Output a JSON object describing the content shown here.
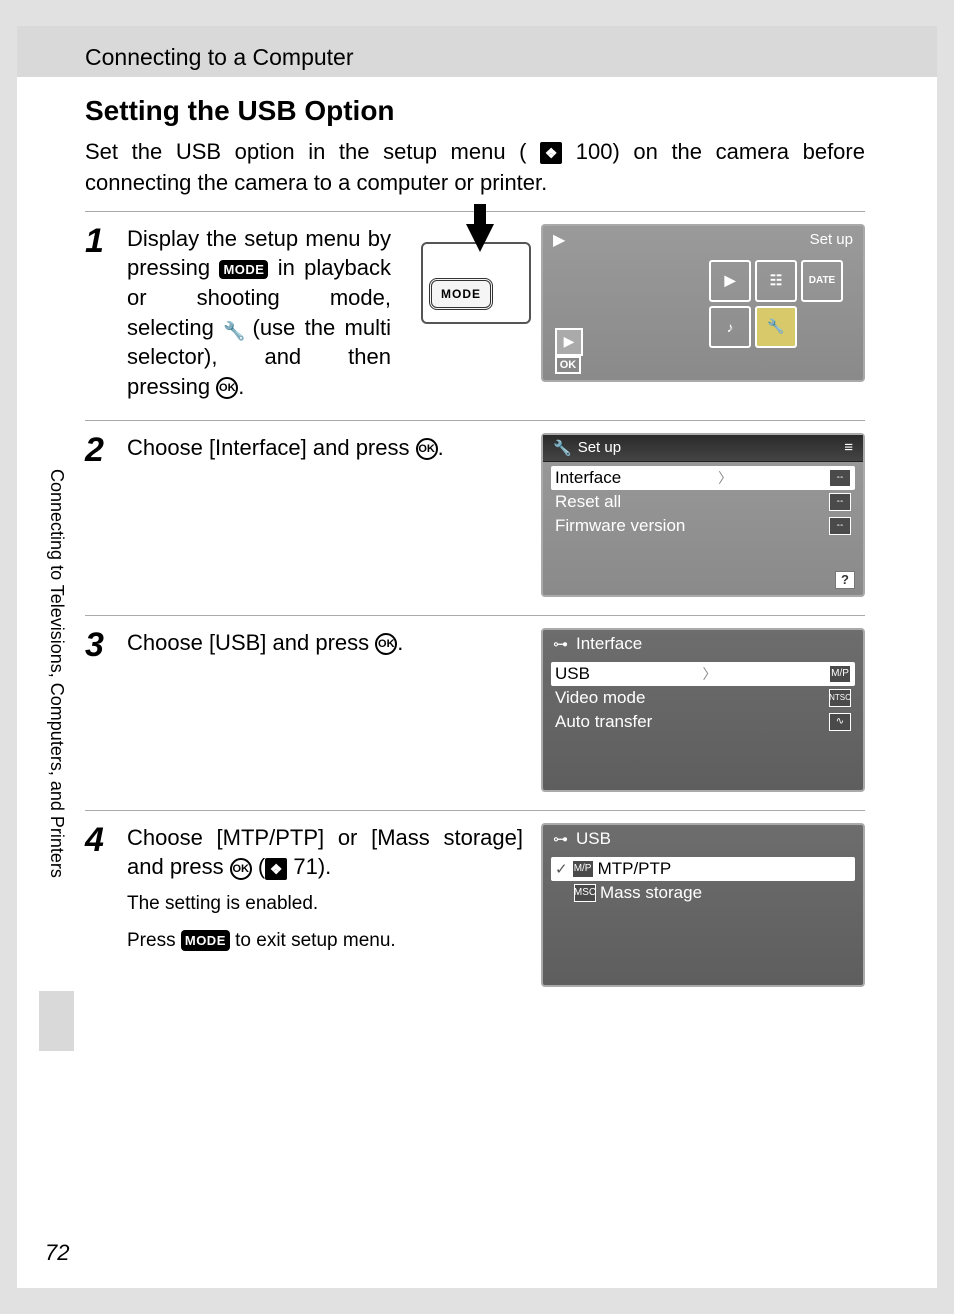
{
  "header": {
    "breadcrumb": "Connecting to a Computer"
  },
  "title": "Setting the USB Option",
  "intro_a": "Set the USB option in the setup menu (",
  "intro_ref": "100",
  "intro_b": ") on the camera before connecting the camera to a computer or printer.",
  "side_label": "Connecting to Televisions, Computers, and Printers",
  "page_number": "72",
  "steps": {
    "s1": {
      "num": "1",
      "t1": "Display the setup menu by pressing",
      "mode": "MODE",
      "t2": "in playback or shooting mode, selecting",
      "t3": "(use the multi selector), and then pressing",
      "t4": ".",
      "cam_mode": "MODE",
      "lcd": {
        "label": "Set up",
        "ok": "OK"
      }
    },
    "s2": {
      "num": "2",
      "t1": "Choose [Interface] and press",
      "t2": ".",
      "lcd": {
        "title": "Set up",
        "items": [
          "Interface",
          "Reset all",
          "Firmware version"
        ],
        "dash": "--"
      }
    },
    "s3": {
      "num": "3",
      "t1": "Choose [USB] and press",
      "t2": ".",
      "lcd": {
        "title": "Interface",
        "items": [
          "USB",
          "Video mode",
          "Auto transfer"
        ],
        "tag1": "M/P",
        "tag2": "NTSC"
      }
    },
    "s4": {
      "num": "4",
      "t1": "Choose [MTP/PTP] or [Mass storage] and press",
      "ref": "71",
      "t2": ").",
      "sub1": "The setting is enabled.",
      "sub2a": "Press",
      "sub2_mode": "MODE",
      "sub2b": "to exit setup menu.",
      "lcd": {
        "title": "USB",
        "items": [
          "MTP/PTP",
          "Mass storage"
        ],
        "tag1": "M/P",
        "tag2": "MSC"
      }
    }
  }
}
